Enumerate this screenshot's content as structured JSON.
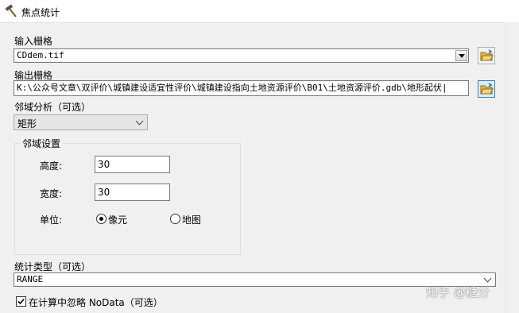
{
  "window": {
    "title": "焦点统计",
    "title_icon": "hammer-icon"
  },
  "input_raster": {
    "label": "输入栅格",
    "value": "CDdem.tif",
    "browse_icon": "open-folder-icon"
  },
  "output_raster": {
    "label": "输出栅格",
    "value": "K:\\公众号文章\\双评价\\城镇建设适宜性评价\\城镇建设指向土地资源评价\\B01\\土地资源评价.gdb\\地形起伏|",
    "browse_icon": "open-folder-icon"
  },
  "neighborhood": {
    "label": "邻域分析（可选）",
    "selected": "矩形"
  },
  "neighborhood_settings": {
    "legend": "邻域设置",
    "height_label": "高度:",
    "height_value": "30",
    "width_label": "宽度:",
    "width_value": "30",
    "units_label": "单位:",
    "unit_cell": "像元",
    "unit_map": "地图",
    "selected_unit": "像元"
  },
  "statistics_type": {
    "label": "统计类型（可选）",
    "selected": "RANGE"
  },
  "ignore_nodata": {
    "label": "在计算中忽略 NoData（可选）",
    "checked": true
  },
  "watermark": "知乎 @糖分"
}
